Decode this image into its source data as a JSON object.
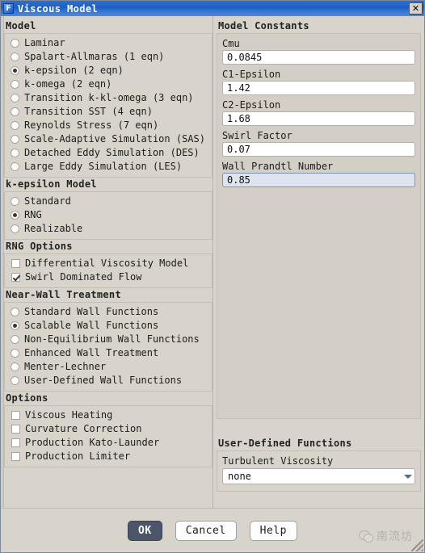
{
  "window": {
    "title": "Viscous Model",
    "icon_label": "F",
    "close_label": "✕"
  },
  "model": {
    "heading": "Model",
    "options": [
      {
        "label": "Laminar",
        "selected": false
      },
      {
        "label": "Spalart-Allmaras (1 eqn)",
        "selected": false
      },
      {
        "label": "k-epsilon (2 eqn)",
        "selected": true
      },
      {
        "label": "k-omega (2 eqn)",
        "selected": false
      },
      {
        "label": "Transition k-kl-omega (3 eqn)",
        "selected": false
      },
      {
        "label": "Transition SST (4 eqn)",
        "selected": false
      },
      {
        "label": "Reynolds Stress (7 eqn)",
        "selected": false
      },
      {
        "label": "Scale-Adaptive Simulation (SAS)",
        "selected": false
      },
      {
        "label": "Detached Eddy Simulation (DES)",
        "selected": false
      },
      {
        "label": "Large Eddy Simulation (LES)",
        "selected": false
      }
    ]
  },
  "k_epsilon_model": {
    "heading": "k-epsilon Model",
    "options": [
      {
        "label": "Standard",
        "selected": false
      },
      {
        "label": "RNG",
        "selected": true
      },
      {
        "label": "Realizable",
        "selected": false
      }
    ]
  },
  "rng_options": {
    "heading": "RNG Options",
    "options": [
      {
        "label": "Differential Viscosity Model",
        "checked": false
      },
      {
        "label": "Swirl Dominated Flow",
        "checked": true
      }
    ]
  },
  "near_wall_treatment": {
    "heading": "Near-Wall Treatment",
    "options": [
      {
        "label": "Standard Wall Functions",
        "selected": false
      },
      {
        "label": "Scalable Wall Functions",
        "selected": true
      },
      {
        "label": "Non-Equilibrium Wall Functions",
        "selected": false
      },
      {
        "label": "Enhanced Wall Treatment",
        "selected": false
      },
      {
        "label": "Menter-Lechner",
        "selected": false
      },
      {
        "label": "User-Defined Wall Functions",
        "selected": false
      }
    ]
  },
  "options": {
    "heading": "Options",
    "items": [
      {
        "label": "Viscous Heating",
        "checked": false
      },
      {
        "label": "Curvature Correction",
        "checked": false
      },
      {
        "label": "Production Kato-Launder",
        "checked": false
      },
      {
        "label": "Production Limiter",
        "checked": false
      }
    ]
  },
  "model_constants": {
    "heading": "Model Constants",
    "fields": [
      {
        "label": "Cmu",
        "value": "0.0845",
        "focused": false
      },
      {
        "label": "C1-Epsilon",
        "value": "1.42",
        "focused": false
      },
      {
        "label": "C2-Epsilon",
        "value": "1.68",
        "focused": false
      },
      {
        "label": "Swirl Factor",
        "value": "0.07",
        "focused": false
      },
      {
        "label": "Wall Prandtl Number",
        "value": "0.85",
        "focused": true
      }
    ]
  },
  "user_defined_functions": {
    "heading": "User-Defined Functions",
    "field_label": "Turbulent Viscosity",
    "selected_value": "none"
  },
  "footer": {
    "ok_label": "OK",
    "cancel_label": "Cancel",
    "help_label": "Help"
  },
  "watermark": {
    "text": "南流坊"
  },
  "colors": {
    "titlebar_blue": "#1d5ec2",
    "dialog_bg": "#d8d4cc",
    "primary_button": "#4c566a",
    "focused_field": "#dde4ef"
  }
}
